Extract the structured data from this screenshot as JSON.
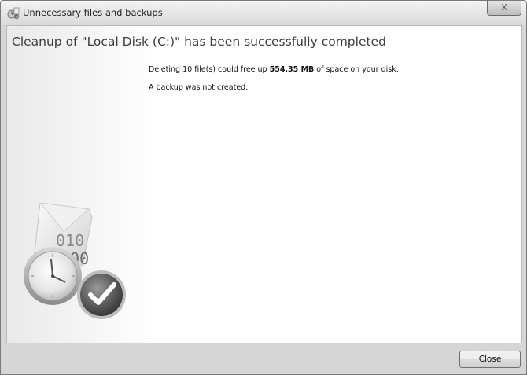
{
  "window": {
    "title": "Unnecessary files and backups",
    "close_glyph": "X"
  },
  "main": {
    "heading": "Cleanup of \"Local Disk (C:)\" has been successfully completed",
    "message1_pre": "Deleting 10 file(s) could free up ",
    "message1_size": "554,35 MB",
    "message1_post": " of space on your disk.",
    "message2": "A backup was not created."
  },
  "illustration": {
    "binary_row1": "010",
    "binary_row2": "100",
    "icons": [
      "clock-icon",
      "checkmark-icon",
      "document-icon"
    ]
  },
  "footer": {
    "close_label": "Close"
  }
}
